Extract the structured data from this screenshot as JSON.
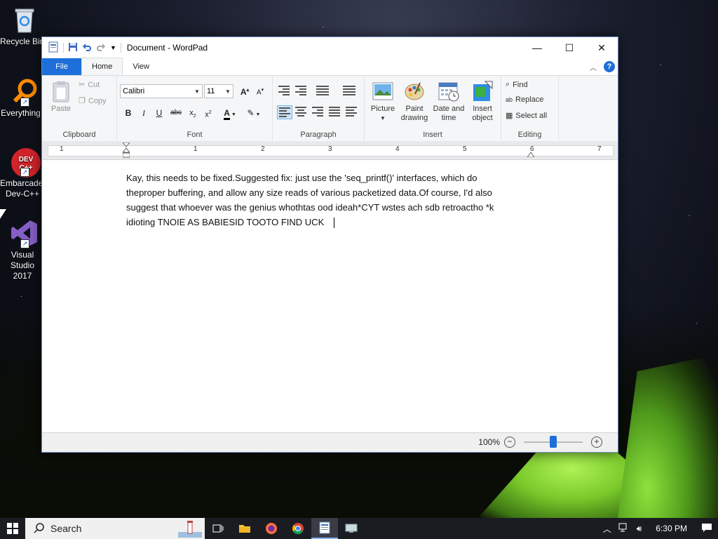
{
  "desktop": {
    "icons": [
      {
        "label": "Recycle Bin",
        "icon": "recycle-bin-icon"
      },
      {
        "label": "Everything",
        "icon": "everything-search-icon"
      },
      {
        "label": "Embarcadero Dev-C++",
        "icon": "dev-cpp-icon"
      },
      {
        "label": "Visual Studio 2017",
        "icon": "visual-studio-icon"
      }
    ]
  },
  "window": {
    "title": "Document - WordPad",
    "controls": {
      "minimize": "—",
      "maximize": "☐",
      "close": "✕"
    }
  },
  "ribbon": {
    "tabs": {
      "file": "File",
      "home": "Home",
      "view": "View"
    },
    "clipboard": {
      "label": "Clipboard",
      "paste": "Paste",
      "cut": "Cut",
      "copy": "Copy"
    },
    "font": {
      "label": "Font",
      "family": "Calibri",
      "size": "11"
    },
    "paragraph": {
      "label": "Paragraph"
    },
    "insert": {
      "label": "Insert",
      "picture": "Picture",
      "paint": "Paint drawing",
      "datetime": "Date and time",
      "object": "Insert object"
    },
    "editing": {
      "label": "Editing",
      "find": "Find",
      "replace": "Replace",
      "select_all": "Select all"
    }
  },
  "ruler": {
    "marks": [
      "1",
      "1",
      "2",
      "3",
      "4",
      "5",
      "6",
      "7"
    ]
  },
  "document": {
    "lines": [
      "Kay, this needs to be fixed.Suggested fix: just use the 'seq_printf()' interfaces, which do",
      "theproper buffering, and allow any size reads of various packetized data.Of course, I'd also",
      "suggest that whoever was the genius whothtas ood ideah*CYT wstes ach sdb retroactho *k",
      "idioting  TNOIE AS BABIESID TOOTO FIND UCK"
    ]
  },
  "statusbar": {
    "zoom": "100%"
  },
  "taskbar": {
    "search_label": "Search",
    "time": "6:30 PM",
    "apps": [
      "task-view-icon",
      "file-explorer-icon",
      "firefox-icon",
      "chrome-icon",
      "wordpad-icon",
      "remote-desktop-icon"
    ]
  }
}
